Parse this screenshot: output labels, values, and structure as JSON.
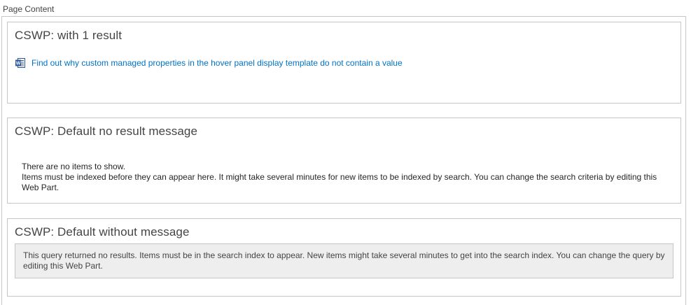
{
  "zone": {
    "label": "Page Content"
  },
  "webparts": [
    {
      "title": "CSWP: with 1 result",
      "result": {
        "icon": "word-document-icon",
        "link_text": "Find out why custom managed properties in the hover panel display template do not contain a value"
      }
    },
    {
      "title": "CSWP: Default no result message",
      "no_items_line": "There are no items to show.",
      "indexed_line": "Items must be indexed before they can appear here. It might take several minutes for new items to be indexed by search. You can change the search criteria by editing this Web Part."
    },
    {
      "title": "CSWP: Default without message",
      "message": "This query returned no results. Items must be in the search index to appear. New items might take several minutes to get into the search index. You can change the query by editing this Web Part."
    }
  ],
  "colors": {
    "link": "#0072c6",
    "border": "#c6c6c6",
    "message_background": "#eeeeee",
    "word_icon": "#2b579a"
  }
}
